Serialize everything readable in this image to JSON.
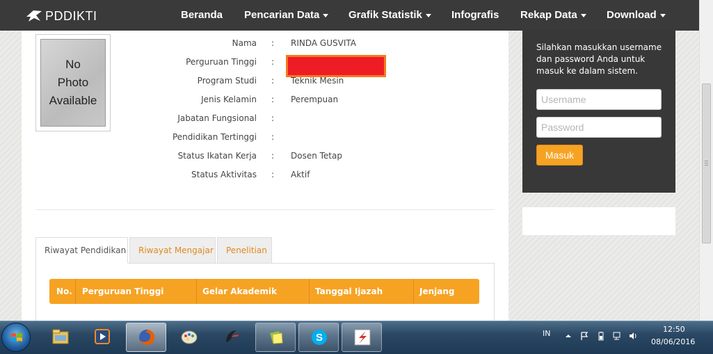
{
  "navbar": {
    "brand": "PDDIKTI",
    "items": [
      {
        "label": "Beranda",
        "dropdown": false
      },
      {
        "label": "Pencarian Data",
        "dropdown": true
      },
      {
        "label": "Grafik Statistik",
        "dropdown": true
      },
      {
        "label": "Infografis",
        "dropdown": false
      },
      {
        "label": "Rekap Data",
        "dropdown": true
      },
      {
        "label": "Download",
        "dropdown": true
      }
    ]
  },
  "profile": {
    "photo_text": "No\nPhoto\nAvailable",
    "fields": [
      {
        "label": "Nama",
        "value": "RINDA GUSVITA"
      },
      {
        "label": "Perguruan Tinggi",
        "value": ""
      },
      {
        "label": "Program Studi",
        "value": "Teknik Mesin"
      },
      {
        "label": "Jenis Kelamin",
        "value": "Perempuan"
      },
      {
        "label": "Jabatan Fungsional",
        "value": ""
      },
      {
        "label": "Pendidikan Tertinggi",
        "value": ""
      },
      {
        "label": "Status Ikatan Kerja",
        "value": "Dosen Tetap"
      },
      {
        "label": "Status Aktivitas",
        "value": "Aktif"
      }
    ],
    "separator": ":"
  },
  "tabs": [
    {
      "label": "Riwayat Pendidikan",
      "active": true
    },
    {
      "label": "Riwayat Mengajar",
      "active": false
    },
    {
      "label": "Penelitian",
      "active": false
    }
  ],
  "table": {
    "headers": [
      "No.",
      "Perguruan Tinggi",
      "Gelar Akademik",
      "Tanggal Ijazah",
      "Jenjang"
    ]
  },
  "login": {
    "message": "Silahkan masukkan username dan password Anda untuk masuk ke dalam sistem.",
    "username_placeholder": "Username",
    "password_placeholder": "Password",
    "submit_label": "Masuk"
  },
  "taskbar": {
    "apps": [
      "explorer-icon",
      "media-player-icon",
      "firefox-icon",
      "paint-icon",
      "app-swirl-icon",
      "sticky-notes-icon",
      "skype-icon",
      "app-s-icon"
    ],
    "language": "IN",
    "time": "12:50",
    "date": "08/06/2016"
  },
  "colors": {
    "navbar": "#3a3a3a",
    "accent": "#f6a323",
    "sidebar": "#383838",
    "redaction": "#ee1c24"
  }
}
